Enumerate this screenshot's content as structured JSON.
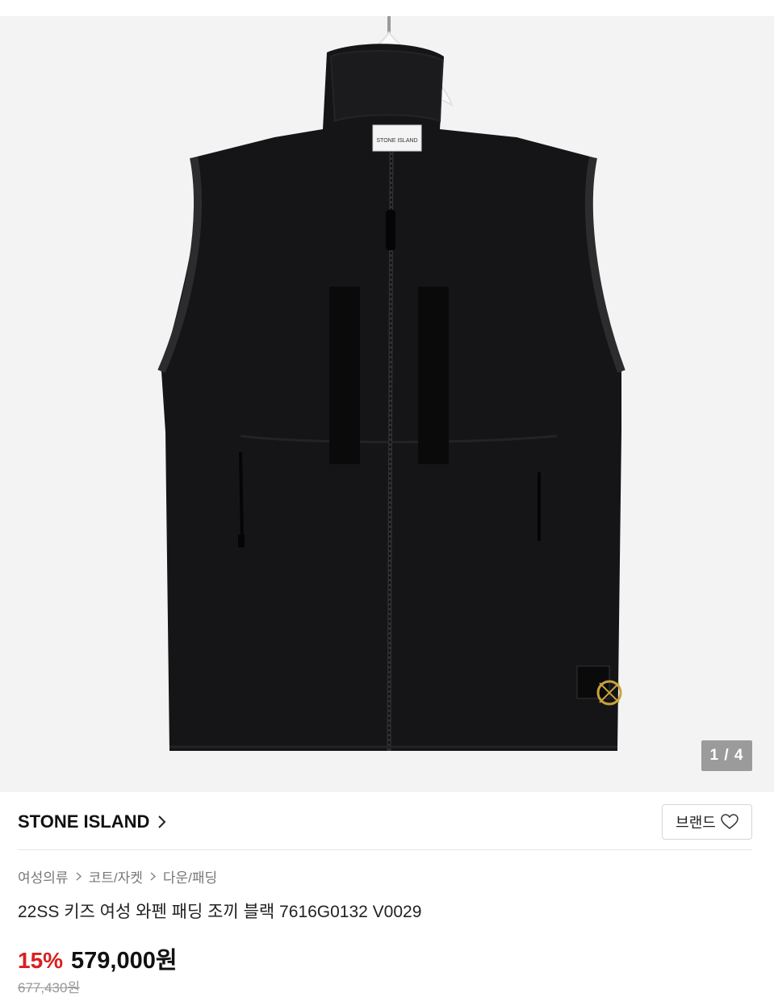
{
  "gallery": {
    "page_indicator": "1 / 4",
    "logo_label_text": "STONE ISLAND"
  },
  "brand": {
    "name": "STONE ISLAND",
    "button_label": "브랜드"
  },
  "breadcrumb": [
    "여성의류",
    "코트/자켓",
    "다운/패딩"
  ],
  "product": {
    "title": "22SS 키즈 여성 와펜 패딩 조끼 블랙 7616G0132 V0029",
    "discount": "15%",
    "price": "579,000원",
    "original_price": "677,430원"
  },
  "colors": {
    "gallery_bg": "#f3f3f3",
    "discount": "#d9201f",
    "garment": "#151517"
  },
  "icons": {
    "brand_chevron": "chevron-right-icon",
    "favorite": "heart-outline-icon",
    "breadcrumb_separator": "chevron-right-icon"
  }
}
